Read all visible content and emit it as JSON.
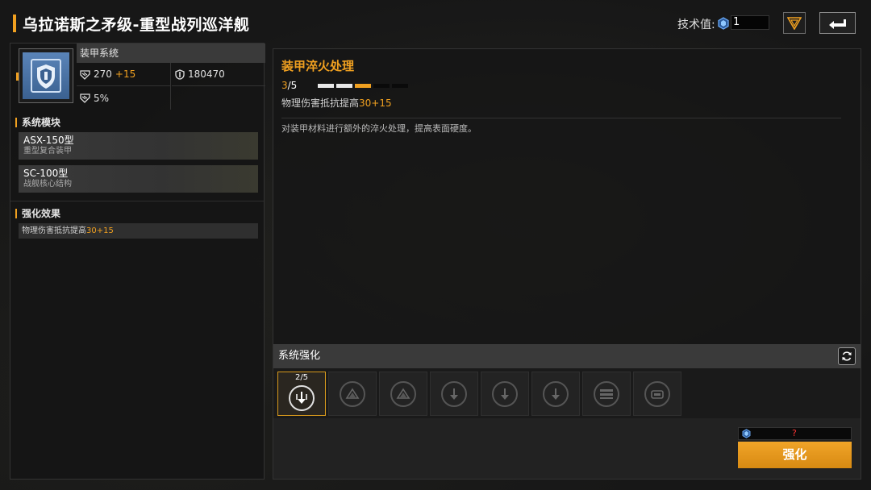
{
  "header": {
    "title": "乌拉诺斯之矛级-重型战列巡洋舰",
    "tech_label": "技术值:",
    "tech_value": "1"
  },
  "system": {
    "name": "装甲系统",
    "icon": "shield-icon",
    "stats": [
      {
        "icon": "armor-icon",
        "value": "270",
        "bonus": "+15"
      },
      {
        "icon": "hull-icon",
        "value": "180470"
      },
      {
        "icon": "armor-icon",
        "value": "5%"
      }
    ]
  },
  "modules": {
    "title": "系统模块",
    "items": [
      {
        "name": "ASX-150型",
        "desc": "重型复合装甲"
      },
      {
        "name": "SC-100型",
        "desc": "战舰核心结构"
      }
    ]
  },
  "effects": {
    "title": "强化效果",
    "items": [
      {
        "text": "物理伤害抵抗提高",
        "value": "30",
        "bonus": "+15"
      }
    ]
  },
  "skill": {
    "title": "装甲淬火处理",
    "level_current": "3",
    "level_sep": "/5",
    "level_value": 3,
    "level_max": 5,
    "stat_text": "物理伤害抵抗提高",
    "stat_value": "30",
    "stat_bonus": "+15",
    "description": "对装甲材料进行额外的淬火处理，提高表面硬度。"
  },
  "enhance": {
    "section_title": "系统强化",
    "slots": [
      {
        "level": "2/5",
        "icon": "arrows-down-icon",
        "active": true
      },
      {
        "icon": "triangle-up-icon"
      },
      {
        "icon": "triangle-up-icon"
      },
      {
        "icon": "arrow-down-icon"
      },
      {
        "icon": "arrow-down-icon"
      },
      {
        "icon": "arrow-down-icon"
      },
      {
        "icon": "stripes-icon"
      },
      {
        "icon": "box-icon"
      }
    ],
    "cost": "?",
    "button": "强化"
  },
  "colors": {
    "accent": "#f0a020",
    "icon_blue": "#4a74a8",
    "cost_red": "#ff3333"
  }
}
